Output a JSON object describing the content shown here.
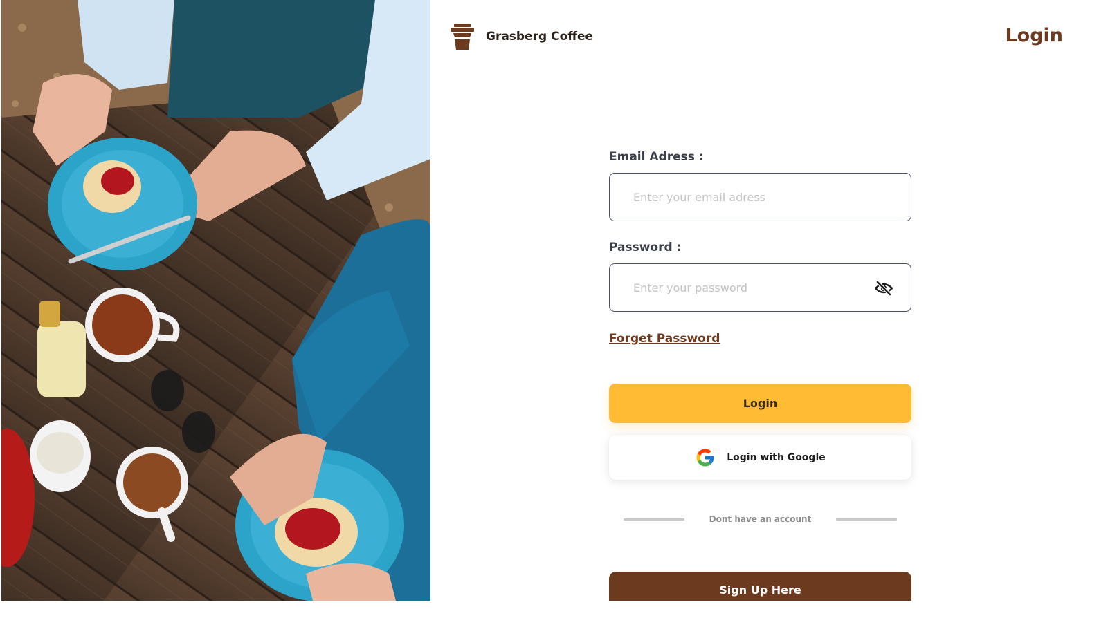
{
  "header": {
    "brand_name": "Grasberg Coffee",
    "page_title": "Login",
    "logo_icon": "coffee-cup-icon"
  },
  "form": {
    "email_label": "Email Adress :",
    "email_placeholder": "Enter your email adress",
    "email_value": "",
    "password_label": "Password :",
    "password_placeholder": "Enter your password",
    "password_value": "",
    "password_toggle_icon": "eye-off-icon",
    "forgot_password": "Forget Password",
    "login_button": "Login",
    "google_button": "Login with Google",
    "google_icon": "google-icon",
    "divider_text": "Dont have an account",
    "signup_button": "Sign Up Here"
  },
  "colors": {
    "brand_brown": "#6b3a1f",
    "accent_yellow": "#ffbb34",
    "text_dark": "#3b3f4a"
  }
}
